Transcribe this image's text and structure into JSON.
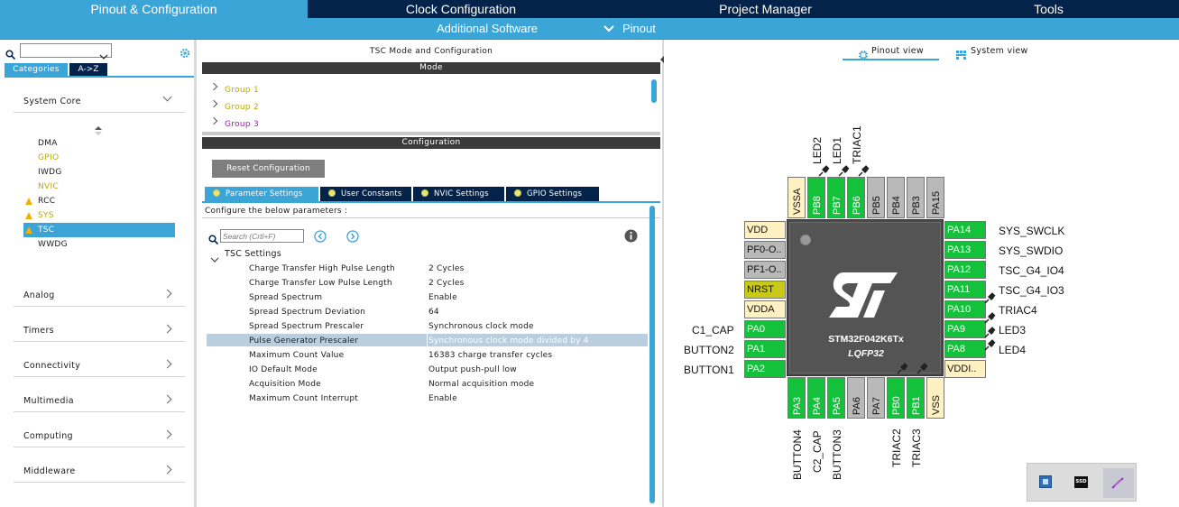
{
  "top_tabs": [
    {
      "label": "Pinout & Configuration",
      "active": true
    },
    {
      "label": "Clock Configuration",
      "active": false
    },
    {
      "label": "Project Manager",
      "active": false
    },
    {
      "label": "Tools",
      "active": false
    }
  ],
  "sub_bar": {
    "additional_software": "Additional Software",
    "pinout": "Pinout"
  },
  "left": {
    "search_value": "",
    "view_tabs": [
      "Categories",
      "A->Z"
    ],
    "system_core": {
      "label": "System Core",
      "items": [
        {
          "label": "DMA",
          "color": "#1b1b1b",
          "warn": false,
          "selected": false
        },
        {
          "label": "GPIO",
          "color": "#b8a900",
          "warn": false,
          "selected": false
        },
        {
          "label": "IWDG",
          "color": "#1b1b1b",
          "warn": false,
          "selected": false
        },
        {
          "label": "NVIC",
          "color": "#b8a900",
          "warn": false,
          "selected": false
        },
        {
          "label": "RCC",
          "color": "#1b1b1b",
          "warn": true,
          "selected": false
        },
        {
          "label": "SYS",
          "color": "#b8a900",
          "warn": true,
          "selected": false
        },
        {
          "label": "TSC",
          "color": "#ffffff",
          "warn": true,
          "selected": true
        },
        {
          "label": "WWDG",
          "color": "#1b1b1b",
          "warn": false,
          "selected": false
        }
      ]
    },
    "categories": [
      "Analog",
      "Timers",
      "Connectivity",
      "Multimedia",
      "Computing",
      "Middleware"
    ]
  },
  "mid": {
    "title": "TSC Mode and Configuration",
    "mode_header": "Mode",
    "groups": [
      {
        "label": "Group 1",
        "color": "#b8a900"
      },
      {
        "label": "Group 2",
        "color": "#b8a900"
      },
      {
        "label": "Group 3",
        "color": "#9b1fa6"
      }
    ],
    "config_header": "Configuration",
    "reset_button": "Reset Configuration",
    "param_tabs": [
      "Parameter Settings",
      "User Constants",
      "NVIC Settings",
      "GPIO Settings"
    ],
    "configure_text": "Configure the below parameters :",
    "search_placeholder": "Search (Crtl+F)",
    "tsc_settings_label": "TSC Settings",
    "params": [
      {
        "label": "Charge Transfer High Pulse Length",
        "value": "2 Cycles",
        "selected": false
      },
      {
        "label": "Charge Transfer Low Pulse Length",
        "value": "2 Cycles",
        "selected": false
      },
      {
        "label": "Spread Spectrum",
        "value": "Enable",
        "selected": false
      },
      {
        "label": "Spread Spectrum Deviation",
        "value": "64",
        "selected": false
      },
      {
        "label": "Spread Spectrum Prescaler",
        "value": "Synchronous clock mode",
        "selected": false
      },
      {
        "label": "Pulse Generator Prescaler",
        "value": "Synchronous clock mode divided by 4",
        "selected": true
      },
      {
        "label": "Maximum Count Value",
        "value": "16383 charge transfer cycles",
        "selected": false
      },
      {
        "label": "IO Default Mode",
        "value": "Output push-pull low",
        "selected": false
      },
      {
        "label": "Acquisition Mode",
        "value": "Normal acquisition mode",
        "selected": false
      },
      {
        "label": "Maximum Count Interrupt",
        "value": "Enable",
        "selected": false
      }
    ]
  },
  "right": {
    "view_tabs": [
      "Pinout view",
      "System view"
    ],
    "chip_name": "STM32F042K6Tx",
    "chip_package": "LQFP32",
    "left_pins": [
      {
        "name": "VDD",
        "color": "y",
        "signal": ""
      },
      {
        "name": "PF0-O..",
        "color": "gr",
        "signal": ""
      },
      {
        "name": "PF1-O..",
        "color": "gr",
        "signal": ""
      },
      {
        "name": "NRST",
        "color": "o",
        "signal": ""
      },
      {
        "name": "VDDA",
        "color": "y",
        "signal": ""
      },
      {
        "name": "PA0",
        "color": "g",
        "signal": "C1_CAP"
      },
      {
        "name": "PA1",
        "color": "g",
        "signal": "BUTTON2"
      },
      {
        "name": "PA2",
        "color": "g",
        "signal": "BUTTON1"
      }
    ],
    "right_pins": [
      {
        "name": "PA14",
        "color": "g",
        "signal": "SYS_SWCLK",
        "pinned": false
      },
      {
        "name": "PA13",
        "color": "g",
        "signal": "SYS_SWDIO",
        "pinned": false
      },
      {
        "name": "PA12",
        "color": "g",
        "signal": "TSC_G4_IO4",
        "pinned": false
      },
      {
        "name": "PA11",
        "color": "g",
        "signal": "TSC_G4_IO3",
        "pinned": true
      },
      {
        "name": "PA10",
        "color": "g",
        "signal": "TRIAC4",
        "pinned": true
      },
      {
        "name": "PA9",
        "color": "g",
        "signal": "LED3",
        "pinned": true
      },
      {
        "name": "PA8",
        "color": "g",
        "signal": "LED4",
        "pinned": true
      },
      {
        "name": "VDDI..",
        "color": "y",
        "signal": "",
        "pinned": false
      }
    ],
    "top_pins": [
      {
        "name": "VSSA",
        "color": "y",
        "signal": "",
        "pinned": false
      },
      {
        "name": "PB8",
        "color": "g",
        "signal": "LED2",
        "pinned": true
      },
      {
        "name": "PB7",
        "color": "g",
        "signal": "LED1",
        "pinned": true
      },
      {
        "name": "PB6",
        "color": "g",
        "signal": "TRIAC1",
        "pinned": true
      },
      {
        "name": "PB5",
        "color": "gr",
        "signal": "",
        "pinned": false
      },
      {
        "name": "PB4",
        "color": "gr",
        "signal": "",
        "pinned": false
      },
      {
        "name": "PB3",
        "color": "gr",
        "signal": "",
        "pinned": false
      },
      {
        "name": "PA15",
        "color": "gr",
        "signal": "",
        "pinned": false
      }
    ],
    "bottom_pins": [
      {
        "name": "PA3",
        "color": "g",
        "signal": "BUTTON4",
        "pinned": false
      },
      {
        "name": "PA4",
        "color": "g",
        "signal": "C2_CAP",
        "pinned": false
      },
      {
        "name": "PA5",
        "color": "g",
        "signal": "BUTTON3",
        "pinned": false
      },
      {
        "name": "PA6",
        "color": "gr",
        "signal": "",
        "pinned": false
      },
      {
        "name": "PA7",
        "color": "gr",
        "signal": "",
        "pinned": false
      },
      {
        "name": "PB0",
        "color": "g",
        "signal": "TRIAC2",
        "pinned": true
      },
      {
        "name": "PB1",
        "color": "g",
        "signal": "TRIAC3",
        "pinned": true
      },
      {
        "name": "VSS",
        "color": "y",
        "signal": "",
        "pinned": false
      }
    ],
    "tray_ssd_label": "SSD"
  }
}
